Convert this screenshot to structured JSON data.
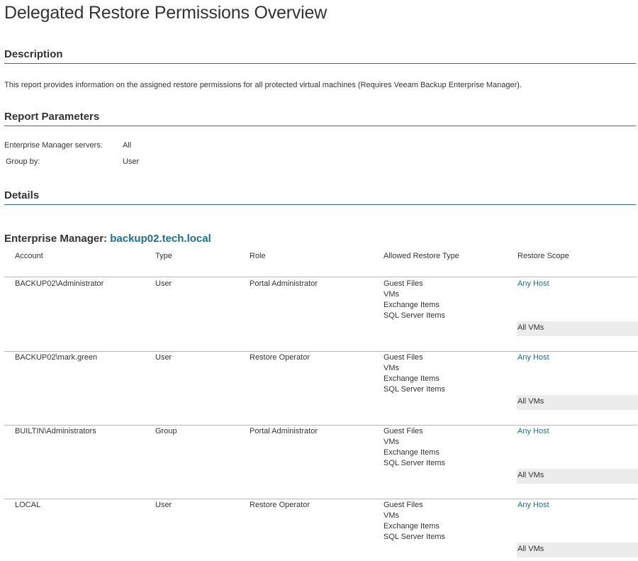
{
  "page_title": "Delegated Restore Permissions Overview",
  "sections": {
    "description": "Description",
    "parameters": "Report Parameters",
    "details": "Details"
  },
  "description_text": "This report provides information on the assigned restore permissions for all protected virtual machines (Requires Veeam Backup Enterprise Manager).",
  "parameters": [
    {
      "label": "Enterprise Manager servers:",
      "value": "All"
    },
    {
      "label": "Group by:",
      "value": "User"
    }
  ],
  "enterprise_manager": {
    "label": "Enterprise Manager:",
    "server": "backup02.tech.local"
  },
  "table": {
    "columns": [
      "Account",
      "Type",
      "Role",
      "Allowed Restore Type",
      "Restore Scope"
    ],
    "rows": [
      {
        "account": "BACKUP02\\Administrator",
        "type": "User",
        "role": "Portal Administrator",
        "restore_types": [
          "Guest Files",
          "VMs",
          "Exchange Items",
          "SQL Server Items"
        ],
        "scope": "Any Host",
        "scope_detail": "All VMs"
      },
      {
        "account": "BACKUP02\\mark.green",
        "type": "User",
        "role": "Restore Operator",
        "restore_types": [
          "Guest Files",
          "VMs",
          "Exchange Items",
          "SQL Server Items"
        ],
        "scope": "Any Host",
        "scope_detail": "All VMs"
      },
      {
        "account": "BUILTIN\\Administrators",
        "type": "Group",
        "role": "Portal Administrator",
        "restore_types": [
          "Guest Files",
          "VMs",
          "Exchange Items",
          "SQL Server Items"
        ],
        "scope": "Any Host",
        "scope_detail": "All VMs"
      },
      {
        "account": "LOCAL",
        "type": "User",
        "role": "Restore Operator",
        "restore_types": [
          "Guest Files",
          "VMs",
          "Exchange Items",
          "SQL Server Items"
        ],
        "scope": "Any Host",
        "scope_detail": "All VMs"
      }
    ]
  }
}
